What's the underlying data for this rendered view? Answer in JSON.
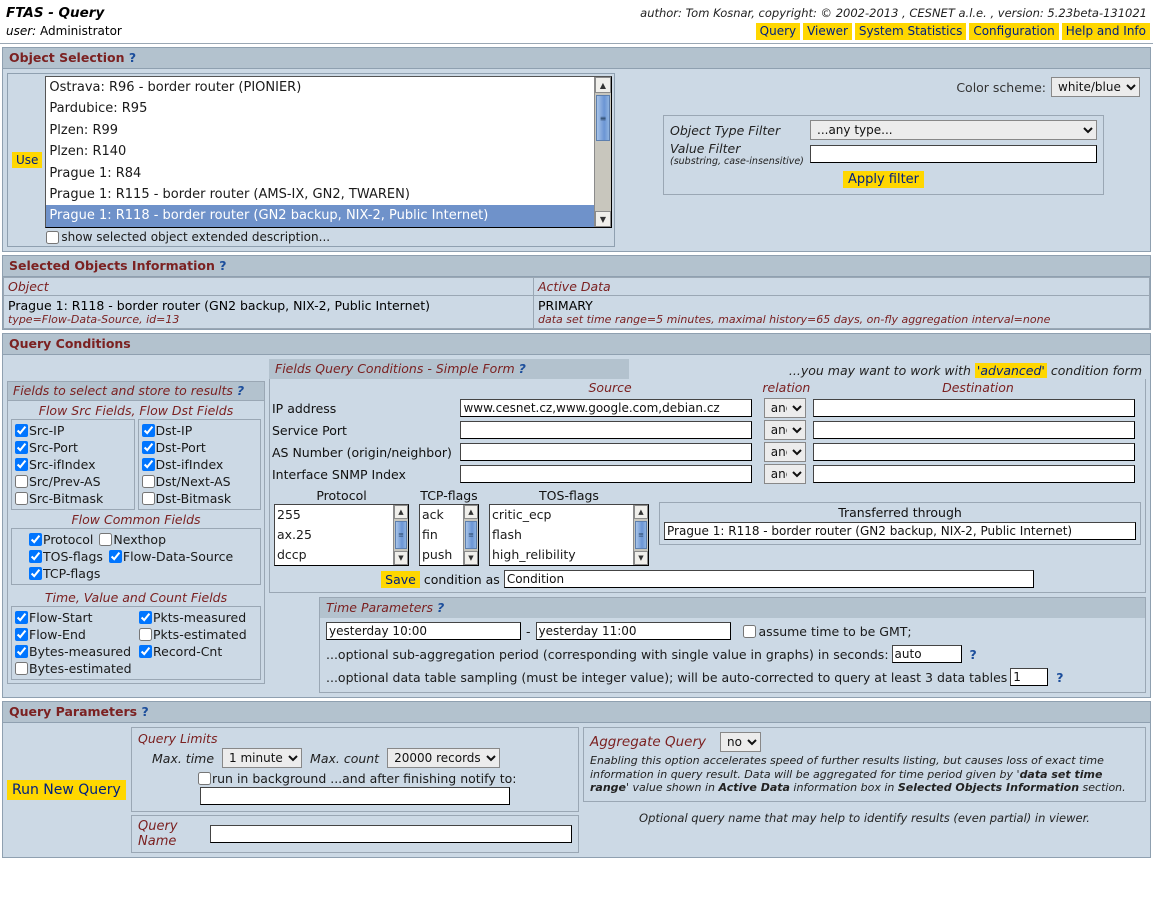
{
  "header": {
    "title": "FTAS - Query",
    "user_label": "user:",
    "user_name": "Administrator",
    "credits": "author: Tom Kosnar, copyright: © 2002-2013 , CESNET a.l.e. , version: 5.23beta-131021",
    "nav": [
      "Query",
      "Viewer",
      "System Statistics",
      "Configuration",
      "Help and Info"
    ]
  },
  "object_selection": {
    "title": "Object Selection",
    "help": "?",
    "use_button": "Use",
    "options": [
      "Ostrava: R96 - border router (PIONIER)",
      "Pardubice: R95",
      "Plzen: R99",
      "Plzen: R140",
      "Prague 1: R84",
      "Prague 1: R115 - border router (AMS-IX, GN2, TWAREN)",
      "Prague 1: R118 - border router (GN2 backup, NIX-2, Public Internet)"
    ],
    "selected_index": 6,
    "extended_description_label": "show selected object extended description...",
    "extended_description_checked": false,
    "color_scheme_label": "Color scheme:",
    "color_scheme_value": "white/blue",
    "object_type_filter_label": "Object Type Filter",
    "object_type_filter_value": "...any type...",
    "value_filter_label": "Value Filter",
    "value_filter_sub": "(substring, case-insensitive)",
    "value_filter_value": "",
    "apply_filter_button": "Apply filter"
  },
  "selected_objects": {
    "title": "Selected Objects Information",
    "help": "?",
    "col_object": "Object",
    "col_active_data": "Active Data",
    "object_name": "Prague 1: R118 - border router (GN2 backup, NIX-2, Public Internet)",
    "object_meta": "type=Flow-Data-Source, id=13",
    "active_data_name": "PRIMARY",
    "active_data_meta": "data set time range=5 minutes, maximal history=65 days, on-fly aggregation interval=none"
  },
  "query_conditions": {
    "title": "Query Conditions",
    "fields_panel": {
      "title": "Fields to select and store to results",
      "help": "?",
      "src_dst_title": "Flow Src Fields, Flow Dst Fields",
      "src_fields": [
        {
          "label": "Src-IP",
          "checked": true
        },
        {
          "label": "Src-Port",
          "checked": true
        },
        {
          "label": "Src-ifIndex",
          "checked": true
        },
        {
          "label": "Src/Prev-AS",
          "checked": false
        },
        {
          "label": "Src-Bitmask",
          "checked": false
        }
      ],
      "dst_fields": [
        {
          "label": "Dst-IP",
          "checked": true
        },
        {
          "label": "Dst-Port",
          "checked": true
        },
        {
          "label": "Dst-ifIndex",
          "checked": true
        },
        {
          "label": "Dst/Next-AS",
          "checked": false
        },
        {
          "label": "Dst-Bitmask",
          "checked": false
        }
      ],
      "common_title": "Flow Common Fields",
      "common_fields_r1": [
        {
          "label": "Protocol",
          "checked": true
        },
        {
          "label": "Nexthop",
          "checked": false
        }
      ],
      "common_fields_r2": [
        {
          "label": "TOS-flags",
          "checked": true
        },
        {
          "label": "Flow-Data-Source",
          "checked": true
        }
      ],
      "common_fields_r3": [
        {
          "label": "TCP-flags",
          "checked": true
        }
      ],
      "time_title": "Time, Value and Count Fields",
      "time_fields_r1": [
        {
          "label": "Flow-Start",
          "checked": true
        },
        {
          "label": "Pkts-measured",
          "checked": true
        }
      ],
      "time_fields_r2": [
        {
          "label": "Flow-End",
          "checked": true
        },
        {
          "label": "Pkts-estimated",
          "checked": false
        }
      ],
      "time_fields_r3": [
        {
          "label": "Bytes-measured",
          "checked": true
        },
        {
          "label": "Record-Cnt",
          "checked": true
        }
      ],
      "time_fields_r4": [
        {
          "label": "Bytes-estimated",
          "checked": false
        }
      ]
    },
    "simple_form": {
      "title": "Fields Query Conditions - Simple Form",
      "help": "?",
      "hint_pre": "...you may want to work with",
      "hint_link": "'advanced'",
      "hint_post": "condition form",
      "col_source": "Source",
      "col_relation": "relation",
      "col_destination": "Destination",
      "rows": [
        {
          "label": "IP address",
          "source": "www.cesnet.cz,www.google.com,debian.cz",
          "relation": "and",
          "destination": ""
        },
        {
          "label": "Service Port",
          "source": "",
          "relation": "and",
          "destination": ""
        },
        {
          "label": "AS Number (origin/neighbor)",
          "source": "",
          "relation": "and",
          "destination": ""
        },
        {
          "label": "Interface SNMP Index",
          "source": "",
          "relation": "and",
          "destination": ""
        }
      ],
      "protocol_title": "Protocol",
      "protocol_options": [
        "255",
        "ax.25",
        "dccp"
      ],
      "tcpflags_title": "TCP-flags",
      "tcpflags_options": [
        "ack",
        "fin",
        "push"
      ],
      "tosflags_title": "TOS-flags",
      "tosflags_options": [
        "critic_ecp",
        "flash",
        "high_relibility"
      ],
      "transferred_title": "Transferred through",
      "transferred_value": "Prague 1: R118 - border router (GN2 backup, NIX-2, Public Internet)",
      "save_button": "Save",
      "save_text": "condition as",
      "save_value": "Condition"
    },
    "time_parameters": {
      "title": "Time Parameters",
      "help": "?",
      "from": "yesterday 10:00",
      "dash": "-",
      "to": "yesterday 11:00",
      "gmt_label": "assume time to be GMT;",
      "gmt_checked": false,
      "subagg_label": "...optional sub-aggregation period (corresponding with single value in graphs) in seconds:",
      "subagg_value": "auto",
      "subagg_help": "?",
      "sampling_label": "...optional data table sampling (must be integer value); will be auto-corrected to query at least 3 data tables",
      "sampling_value": "1",
      "sampling_help": "?"
    }
  },
  "query_parameters": {
    "title": "Query Parameters",
    "help": "?",
    "run_button": "Run New Query",
    "limits_title": "Query Limits",
    "max_time_label": "Max. time",
    "max_time_value": "1 minute",
    "max_count_label": "Max. count",
    "max_count_value": "20000 records",
    "background_label": "run in background ...and after finishing notify to:",
    "background_checked": false,
    "notify_value": "",
    "query_name_label": "Query Name",
    "query_name_value": "",
    "aggregate_label": "Aggregate Query",
    "aggregate_value": "no",
    "aggregate_desc_1": "Enabling this option accelerates speed of further results listing, but causes loss of exact time information in query result. Data will be aggregated for time period given by '",
    "aggregate_desc_b1": "data set time range",
    "aggregate_desc_2": "' value shown in ",
    "aggregate_desc_b2": "Active Data",
    "aggregate_desc_3": " information box in ",
    "aggregate_desc_b3": "Selected Objects Information",
    "aggregate_desc_4": " section.",
    "query_name_hint": "Optional query name that may help to identify results (even partial) in viewer."
  }
}
